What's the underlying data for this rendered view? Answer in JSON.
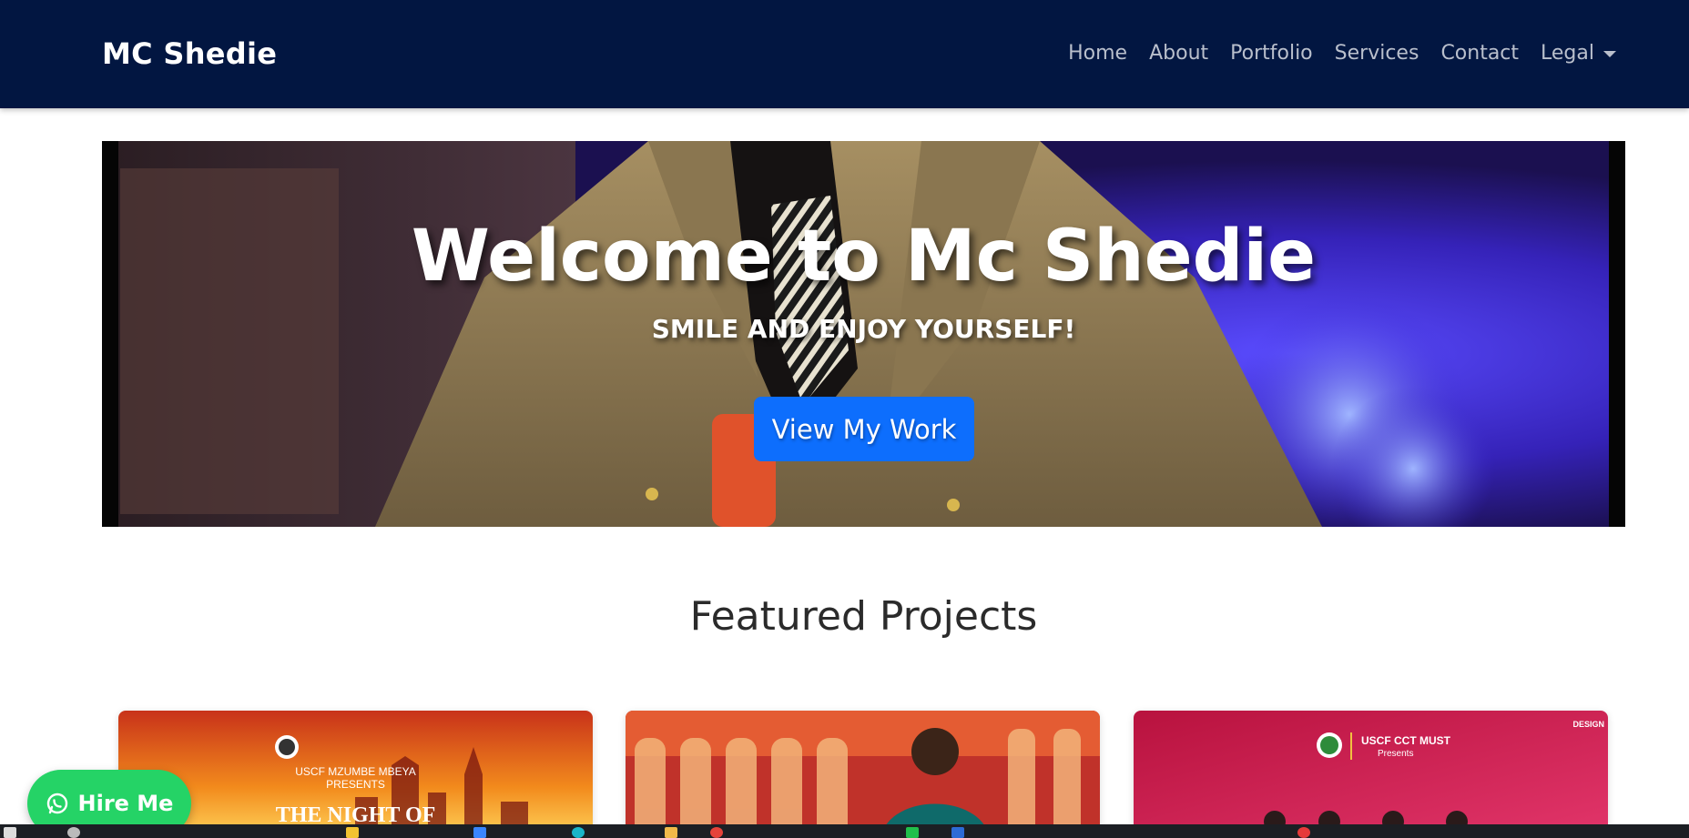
{
  "navbar": {
    "brand": "MC Shedie",
    "links": [
      "Home",
      "About",
      "Portfolio",
      "Services",
      "Contact",
      "Legal"
    ]
  },
  "hero": {
    "title": "Welcome to Mc Shedie",
    "subtitle": "SMILE AND ENJOY YOURSELF!",
    "button_label": "View My Work"
  },
  "featured": {
    "title": "Featured Projects",
    "cards": [
      {
        "line1": "USCF MZUMBE MBEYA",
        "line2": "PRESENTS",
        "headline": "THE NIGHT OF"
      },
      {
        "line1": "",
        "line2": "",
        "headline": ""
      },
      {
        "line1": "USCF CCT MUST",
        "line2": "Presents",
        "headline": "",
        "badge": "DESIGN"
      }
    ]
  },
  "hire": {
    "label": "Hire Me",
    "icon": "whatsapp-icon"
  },
  "colors": {
    "navbar": "#021641",
    "primary_button": "#0d6efd",
    "hire_button": "#25d366"
  }
}
